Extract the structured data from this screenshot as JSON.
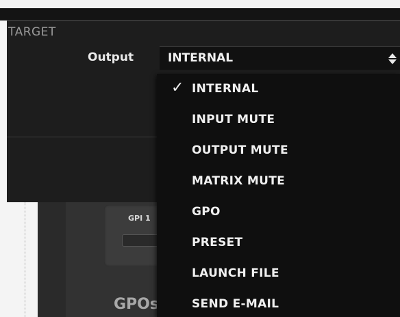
{
  "target": {
    "section_title": "TARGET",
    "output_label": "Output",
    "output_value": "INTERNAL",
    "output_options": [
      {
        "label": "INTERNAL",
        "selected": true
      },
      {
        "label": "INPUT MUTE",
        "selected": false
      },
      {
        "label": "OUTPUT MUTE",
        "selected": false
      },
      {
        "label": "MATRIX MUTE",
        "selected": false
      },
      {
        "label": "GPO",
        "selected": false
      },
      {
        "label": "PRESET",
        "selected": false
      },
      {
        "label": "LAUNCH FILE",
        "selected": false
      },
      {
        "label": "SEND E-MAIL",
        "selected": false
      }
    ],
    "check_glyph": "✓"
  },
  "background": {
    "gpi_label": "GPI 1",
    "gpos_label": "GPOs"
  },
  "colors": {
    "panel": "#1d1d1d",
    "menu": "#0f0f0f",
    "text": "#f0f0f0"
  }
}
